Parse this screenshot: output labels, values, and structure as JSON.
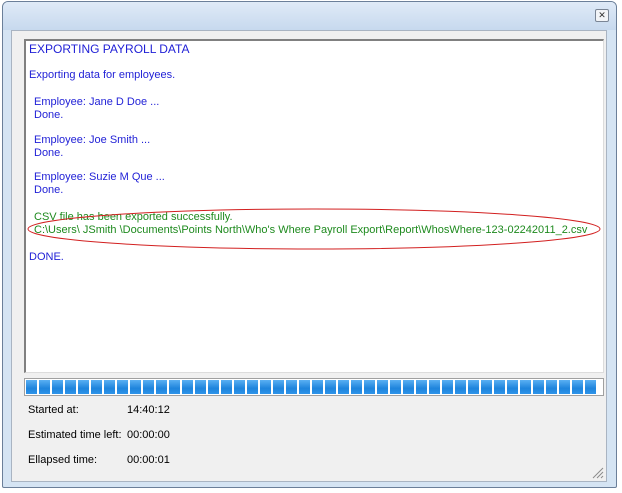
{
  "window": {
    "close_icon": "close-icon"
  },
  "log": {
    "heading": "EXPORTING PAYROLL DATA",
    "intro": "Exporting data for employees.",
    "entries": [
      {
        "employee": "Employee: Jane D Doe ...",
        "status": "Done."
      },
      {
        "employee": "Employee: Joe Smith ...",
        "status": "Done."
      },
      {
        "employee": "Employee: Suzie M Que ...",
        "status": "Done."
      }
    ],
    "csv_message": "CSV file has been exported successfully.",
    "csv_path_prefix": "C:\\Users\\",
    "csv_path_user": "JSmith",
    "csv_path_rest": "\\Documents\\Points North\\Who's Where Payroll Export\\Report\\WhosWhere-123-02242011_2.csv",
    "done": "DONE.",
    "colors": {
      "text_blue": "#1f1fd6",
      "text_green": "#1e8a1e",
      "annotation_red": "#d22020"
    }
  },
  "progress": {
    "percent": 100,
    "color": "#1e84dc"
  },
  "stats": {
    "started_label": "Started at:",
    "started_value": "14:40:12",
    "estimated_label": "Estimated time left:",
    "estimated_value": "00:00:00",
    "elapsed_label": "Ellapsed time:",
    "elapsed_value": "00:00:01"
  }
}
